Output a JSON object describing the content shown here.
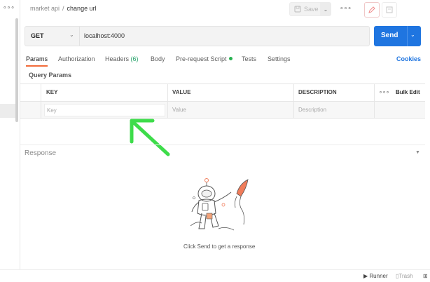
{
  "sidebar": {
    "more_icon": "more-dots-icon"
  },
  "breadcrumb": {
    "collection": "market api",
    "separator": "/",
    "request": "change url"
  },
  "toolbar": {
    "save_label": "Save",
    "more_icon": "more-dots-icon",
    "edit_icon": "pencil-icon",
    "docs_icon": "doc-icon"
  },
  "request": {
    "method": "GET",
    "url": "localhost:4000",
    "send_label": "Send"
  },
  "tabs": [
    {
      "label": "Params"
    },
    {
      "label": "Authorization"
    },
    {
      "label": "Headers",
      "count": "(6)"
    },
    {
      "label": "Body"
    },
    {
      "label": "Pre-request Script"
    },
    {
      "label": "Tests"
    },
    {
      "label": "Settings"
    }
  ],
  "cookies_label": "Cookies",
  "query_params": {
    "title": "Query Params",
    "columns": [
      "KEY",
      "VALUE",
      "DESCRIPTION"
    ],
    "key_placeholder": "Key",
    "value_placeholder": "Value",
    "description_placeholder": "Description",
    "more_icon": "more-dots-icon",
    "bulk_edit_label": "Bulk Edit"
  },
  "response": {
    "title": "Response",
    "empty_message": "Click Send to get a response"
  },
  "footer": {
    "runner_label": "Runner",
    "trash_label": "Trash"
  },
  "colors": {
    "accent": "#1f75e0",
    "tab_underline": "#f26b3a",
    "success_green": "#26b14f",
    "annotation_arrow": "#3ddc4a"
  }
}
